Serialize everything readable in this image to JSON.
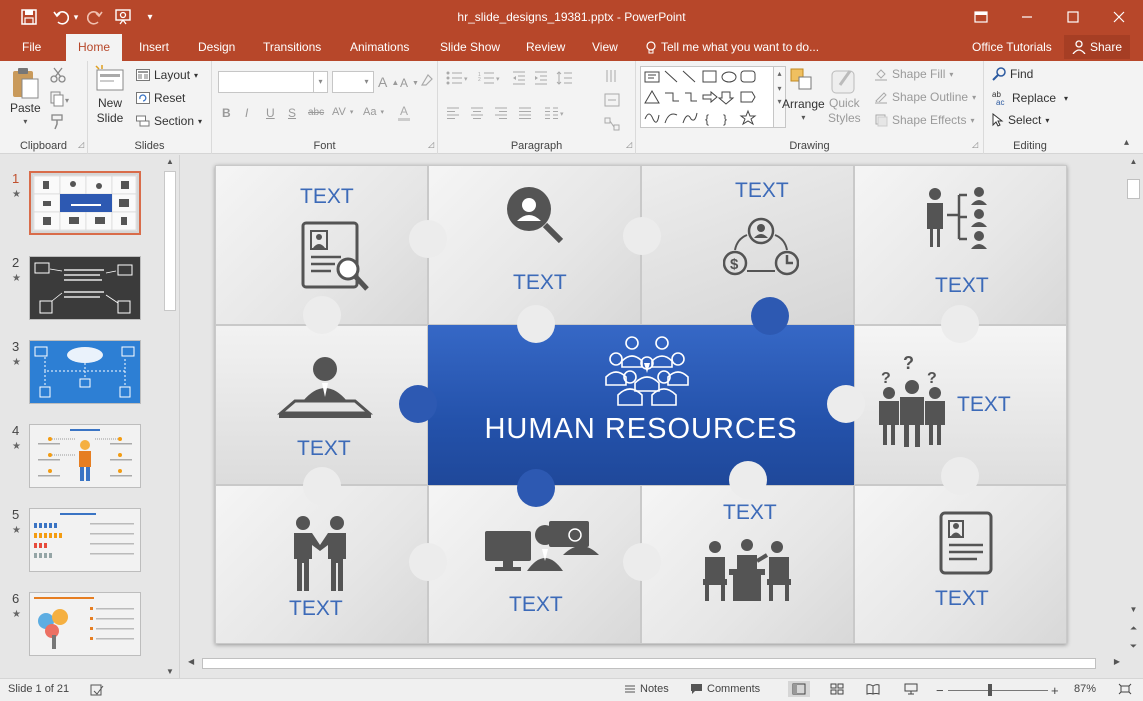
{
  "window": {
    "title": "hr_slide_designs_19381.pptx - PowerPoint"
  },
  "tabs": [
    "File",
    "Home",
    "Insert",
    "Design",
    "Transitions",
    "Animations",
    "Slide Show",
    "Review",
    "View"
  ],
  "tell_me": "Tell me what you want to do...",
  "account": {
    "name": "Office Tutorials",
    "share": "Share"
  },
  "ribbon": {
    "clipboard": {
      "label": "Clipboard",
      "paste": "Paste"
    },
    "slides": {
      "label": "Slides",
      "new_slide_1": "New",
      "new_slide_2": "Slide",
      "layout": "Layout",
      "reset": "Reset",
      "section": "Section"
    },
    "font": {
      "label": "Font"
    },
    "paragraph": {
      "label": "Paragraph"
    },
    "drawing": {
      "label": "Drawing",
      "arrange": "Arrange",
      "quick_styles_1": "Quick",
      "quick_styles_2": "Styles",
      "shape_fill": "Shape Fill",
      "shape_outline": "Shape Outline",
      "shape_effects": "Shape Effects"
    },
    "editing": {
      "label": "Editing",
      "find": "Find",
      "replace": "Replace",
      "select": "Select"
    }
  },
  "thumbnails": [
    {
      "num": "1",
      "selected": true
    },
    {
      "num": "2"
    },
    {
      "num": "3"
    },
    {
      "num": "4"
    },
    {
      "num": "5"
    },
    {
      "num": "6"
    }
  ],
  "slide": {
    "center_title": "HUMAN RESOURCES",
    "piece_text": "TEXT"
  },
  "status": {
    "slide": "Slide 1 of 21",
    "notes": "Notes",
    "comments": "Comments",
    "zoom": "87%"
  },
  "colors": {
    "accent": "#b7472a",
    "slide_blue": "#2d59b2",
    "text_blue": "#3c6ab8",
    "icon_gray": "#545454"
  }
}
